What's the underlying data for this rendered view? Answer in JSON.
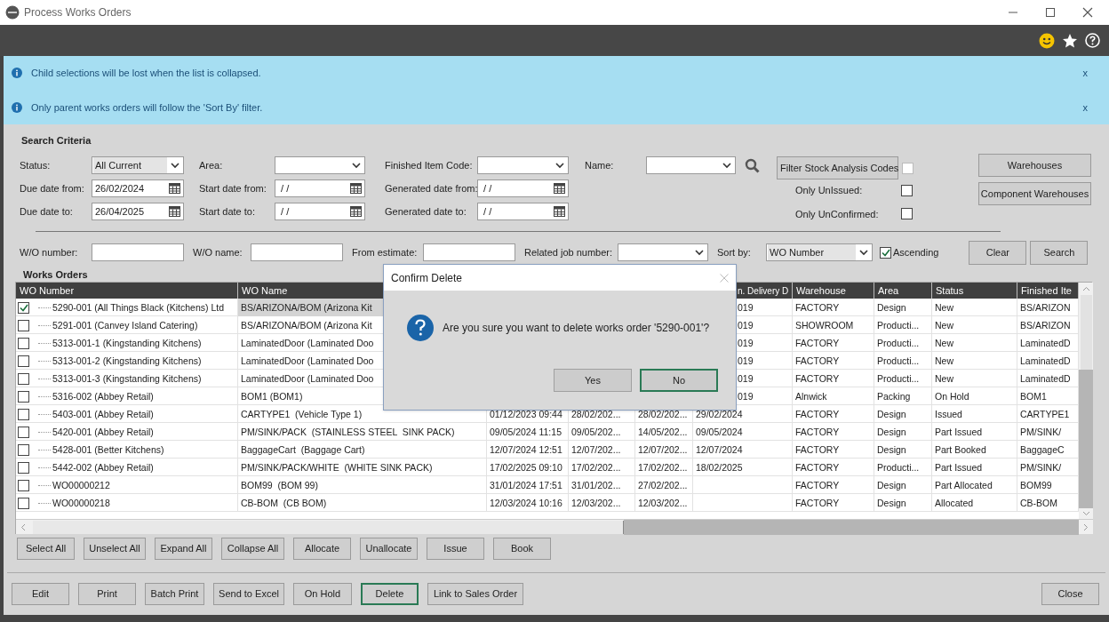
{
  "window": {
    "title": "Process Works Orders"
  },
  "notices": [
    {
      "text": "Child selections will be lost when the list is collapsed.",
      "close": "x"
    },
    {
      "text": "Only parent works orders will follow the 'Sort By' filter.",
      "close": "x"
    }
  ],
  "search_criteria": {
    "title": "Search Criteria",
    "row_1": [
      {
        "kind": "dropdown",
        "label": "Status:",
        "value": "All Current"
      },
      {
        "kind": "dropdown",
        "label": "Area:"
      },
      {
        "kind": "dropdown",
        "label": "Finished Item Code:"
      },
      {
        "kind": "dropdown",
        "label": "Name:"
      }
    ],
    "row_2": [
      {
        "kind": "date",
        "label": "Due date from:",
        "value": "26/02/2024"
      },
      {
        "kind": "date",
        "label": "Start date from:",
        "value": " / /"
      },
      {
        "kind": "date",
        "label": "Generated date from:",
        "value": " / /"
      }
    ],
    "row_3": [
      {
        "kind": "date",
        "label": "Due date to:",
        "value": "26/04/2025"
      },
      {
        "kind": "date",
        "label": "Start date to:",
        "value": " / /"
      },
      {
        "kind": "date",
        "label": "Generated date to:",
        "value": " / /"
      }
    ],
    "filter_stock_analysis_codes": {
      "label": "Filter Stock Analysis Codes",
      "checked": false
    },
    "only_unissued": {
      "label": "Only UnIssued:",
      "checked": false
    },
    "only_unconfirmed": {
      "label": "Only UnConfirmed:",
      "checked": false
    },
    "warehouses_button": "Warehouses",
    "component_warehouses_button": "Component Warehouses",
    "row_4": [
      {
        "kind": "text",
        "label": "W/O number:"
      },
      {
        "kind": "text",
        "label": "W/O name:"
      },
      {
        "kind": "text",
        "label": "From estimate:"
      },
      {
        "kind": "dropdown",
        "label": "Related job number:"
      },
      {
        "kind": "dropdown",
        "label": "Sort by:",
        "value": "WO Number"
      }
    ],
    "ascending": {
      "label": "Ascending",
      "checked": true
    },
    "buttons": [
      "Clear",
      "Search"
    ]
  },
  "works_orders": {
    "title": "Works Orders",
    "columns": [
      "WO Number",
      "WO Name",
      null,
      null,
      null,
      "n. Delivery D",
      "Warehouse",
      "Area",
      "Status",
      "Finished Ite"
    ],
    "rows": [
      {
        "checked": true,
        "selected": true,
        "cells": [
          "5290-001 (All Things Black (Kitchens) Ltd",
          "BS/ARIZONA/BOM (Arizona Kit",
          null,
          null,
          null,
          "019",
          "FACTORY",
          "Design",
          "New",
          "BS/ARIZON"
        ]
      },
      {
        "checked": false,
        "selected": false,
        "cells": [
          "5291-001 (Canvey Island Catering)",
          "BS/ARIZONA/BOM (Arizona Kit",
          null,
          null,
          null,
          "019",
          "SHOWROOM",
          "Producti...",
          "New",
          "BS/ARIZON"
        ]
      },
      {
        "checked": false,
        "selected": false,
        "cells": [
          "5313-001-1 (Kingstanding Kitchens)",
          "LaminatedDoor (Laminated Doo",
          null,
          null,
          null,
          "019",
          "FACTORY",
          "Producti...",
          "New",
          "LaminatedD"
        ]
      },
      {
        "checked": false,
        "selected": false,
        "cells": [
          "5313-001-2 (Kingstanding Kitchens)",
          "LaminatedDoor (Laminated Doo",
          null,
          null,
          null,
          "019",
          "FACTORY",
          "Producti...",
          "New",
          "LaminatedD"
        ]
      },
      {
        "checked": false,
        "selected": false,
        "cells": [
          "5313-001-3 (Kingstanding Kitchens)",
          "LaminatedDoor (Laminated Doo",
          null,
          null,
          null,
          "019",
          "FACTORY",
          "Producti...",
          "New",
          "LaminatedD"
        ]
      },
      {
        "checked": false,
        "selected": false,
        "cells": [
          "5316-002 (Abbey Retail)",
          "BOM1 (BOM1)",
          null,
          null,
          null,
          "019",
          "Alnwick",
          "Packing",
          "On Hold",
          "BOM1"
        ]
      },
      {
        "checked": false,
        "selected": false,
        "cells": [
          "5403-001 (Abbey Retail)",
          "CARTYPE1  (Vehicle Type 1)",
          "01/12/2023 09:44",
          "28/02/202...",
          "28/02/202...",
          "29/02/2024",
          "FACTORY",
          "Design",
          "Issued",
          "CARTYPE1"
        ]
      },
      {
        "checked": false,
        "selected": false,
        "cells": [
          "5420-001 (Abbey Retail)",
          "PM/SINK/PACK  (STAINLESS STEEL  SINK PACK)",
          "09/05/2024 11:15",
          "09/05/202...",
          "14/05/202...",
          "09/05/2024",
          "FACTORY",
          "Design",
          "Part Issued",
          "PM/SINK/"
        ]
      },
      {
        "checked": false,
        "selected": false,
        "cells": [
          "5428-001 (Better Kitchens)",
          "BaggageCart  (Baggage Cart)",
          "12/07/2024 12:51",
          "12/07/202...",
          "12/07/202...",
          "12/07/2024",
          "FACTORY",
          "Design",
          "Part Booked",
          "BaggageC"
        ]
      },
      {
        "checked": false,
        "selected": false,
        "cells": [
          "5442-002 (Abbey Retail)",
          "PM/SINK/PACK/WHITE  (WHITE SINK PACK)",
          "17/02/2025 09:10",
          "17/02/202...",
          "17/02/202...",
          "18/02/2025",
          "FACTORY",
          "Producti...",
          "Part Issued",
          "PM/SINK/"
        ]
      },
      {
        "checked": false,
        "selected": false,
        "cells": [
          "WO00000212",
          "BOM99  (BOM 99)",
          "31/01/2024 17:51",
          "31/01/202...",
          "27/02/202...",
          null,
          "FACTORY",
          "Design",
          "Part Allocated",
          "BOM99"
        ]
      },
      {
        "checked": false,
        "selected": false,
        "cells": [
          "WO00000218",
          "CB-BOM  (CB BOM)",
          "12/03/2024 10:16",
          "12/03/202...",
          "12/03/202...",
          null,
          "FACTORY",
          "Design",
          "Allocated",
          "CB-BOM"
        ]
      }
    ]
  },
  "list_buttons": [
    "Select All",
    "Unselect All",
    "Expand All",
    "Collapse All",
    "Allocate",
    "Unallocate",
    "Issue",
    "Book"
  ],
  "action_buttons": [
    {
      "label": "Edit",
      "focused": false
    },
    {
      "label": "Print",
      "focused": false
    },
    {
      "label": "Batch Print",
      "focused": false
    },
    {
      "label": "Send to Excel",
      "focused": false
    },
    {
      "label": "On Hold",
      "focused": false
    },
    {
      "label": "Delete",
      "focused": true
    },
    {
      "label": "Link to Sales Order",
      "focused": false
    }
  ],
  "close_button": "Close",
  "dialog": {
    "title": "Confirm Delete",
    "message": "Are you sure you want to delete works order '5290-001'?",
    "buttons": [
      {
        "label": "Yes",
        "focused": false
      },
      {
        "label": "No",
        "focused": true
      }
    ]
  }
}
